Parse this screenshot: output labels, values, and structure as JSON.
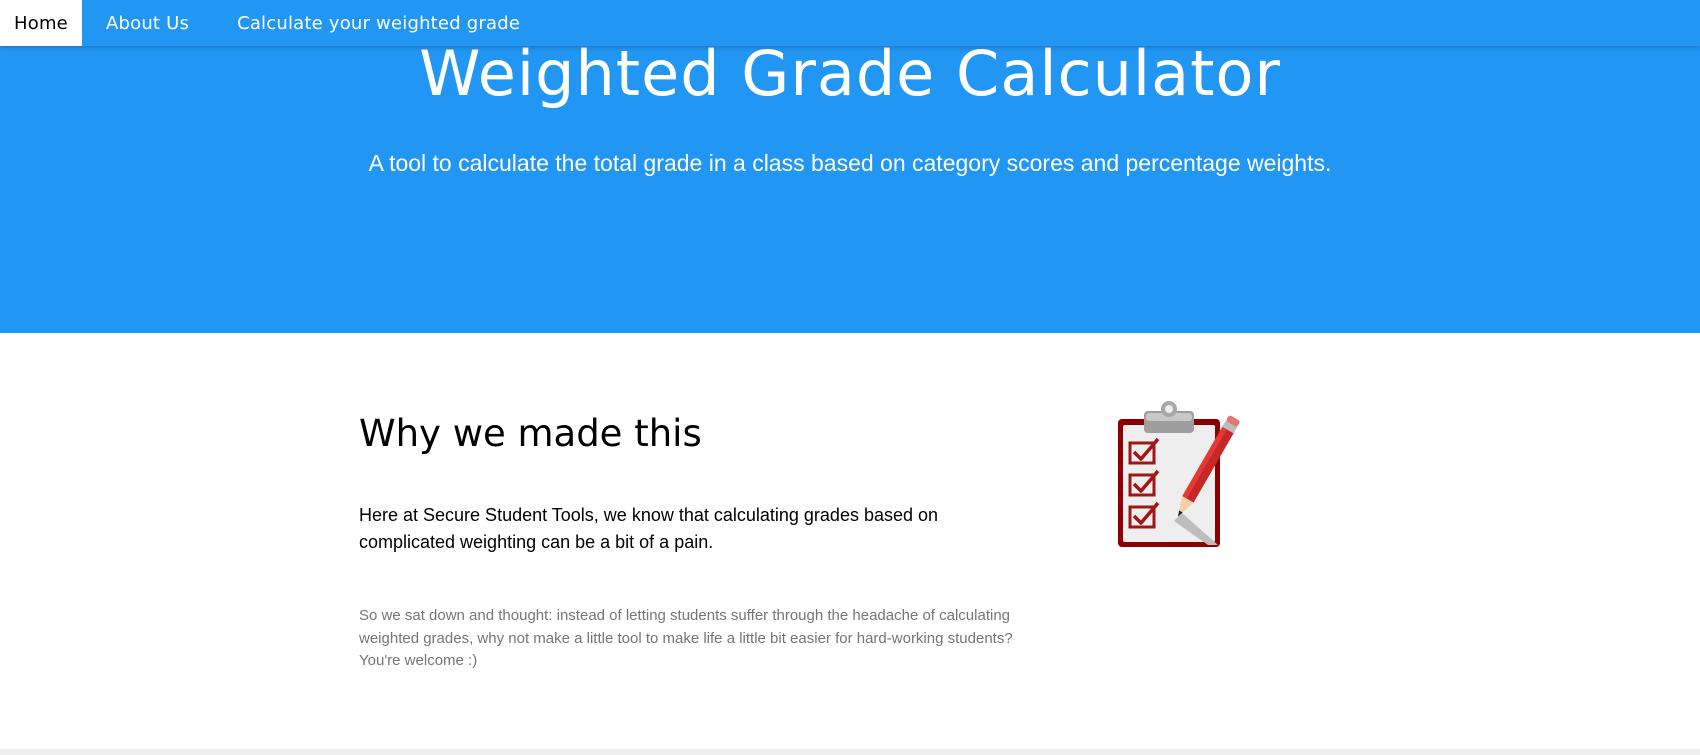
{
  "nav": {
    "items": [
      {
        "label": "Home",
        "active": true
      },
      {
        "label": "About Us",
        "active": false
      },
      {
        "label": "Calculate your weighted grade",
        "active": false
      }
    ]
  },
  "hero": {
    "title": "Weighted Grade Calculator",
    "subtitle": "A tool to calculate the total grade in a class based on category scores and percentage weights."
  },
  "about": {
    "heading": "Why we made this",
    "lead": "Here at Secure Student Tools, we know that calculating grades based on complicated weighting can be a bit of a pain.",
    "body": "So we sat down and thought: instead of letting students suffer through the headache of calculating weighted grades, why not make a little tool to make life a little bit easier for hard-working students? You're welcome :)",
    "illustration": "clipboard-checklist-icon"
  },
  "colors": {
    "primary": "#2196f3",
    "nav_active_bg": "#ffffff",
    "body_text": "#757575",
    "checklist_red": "#8b0000"
  }
}
